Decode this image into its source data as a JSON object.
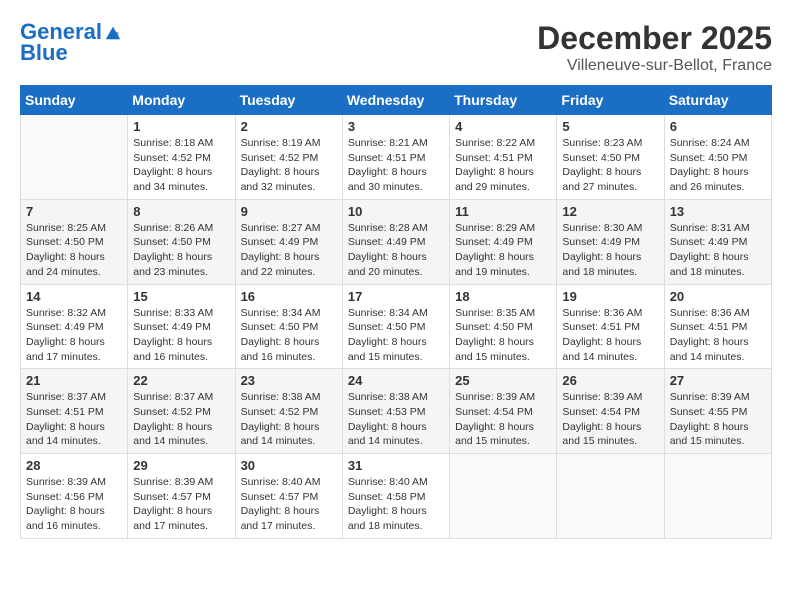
{
  "header": {
    "logo_line1": "General",
    "logo_line2": "Blue",
    "month_title": "December 2025",
    "location": "Villeneuve-sur-Bellot, France"
  },
  "weekdays": [
    "Sunday",
    "Monday",
    "Tuesday",
    "Wednesday",
    "Thursday",
    "Friday",
    "Saturday"
  ],
  "weeks": [
    [
      {
        "day": "",
        "sunrise": "",
        "sunset": "",
        "daylight": ""
      },
      {
        "day": "1",
        "sunrise": "Sunrise: 8:18 AM",
        "sunset": "Sunset: 4:52 PM",
        "daylight": "Daylight: 8 hours and 34 minutes."
      },
      {
        "day": "2",
        "sunrise": "Sunrise: 8:19 AM",
        "sunset": "Sunset: 4:52 PM",
        "daylight": "Daylight: 8 hours and 32 minutes."
      },
      {
        "day": "3",
        "sunrise": "Sunrise: 8:21 AM",
        "sunset": "Sunset: 4:51 PM",
        "daylight": "Daylight: 8 hours and 30 minutes."
      },
      {
        "day": "4",
        "sunrise": "Sunrise: 8:22 AM",
        "sunset": "Sunset: 4:51 PM",
        "daylight": "Daylight: 8 hours and 29 minutes."
      },
      {
        "day": "5",
        "sunrise": "Sunrise: 8:23 AM",
        "sunset": "Sunset: 4:50 PM",
        "daylight": "Daylight: 8 hours and 27 minutes."
      },
      {
        "day": "6",
        "sunrise": "Sunrise: 8:24 AM",
        "sunset": "Sunset: 4:50 PM",
        "daylight": "Daylight: 8 hours and 26 minutes."
      }
    ],
    [
      {
        "day": "7",
        "sunrise": "Sunrise: 8:25 AM",
        "sunset": "Sunset: 4:50 PM",
        "daylight": "Daylight: 8 hours and 24 minutes."
      },
      {
        "day": "8",
        "sunrise": "Sunrise: 8:26 AM",
        "sunset": "Sunset: 4:50 PM",
        "daylight": "Daylight: 8 hours and 23 minutes."
      },
      {
        "day": "9",
        "sunrise": "Sunrise: 8:27 AM",
        "sunset": "Sunset: 4:49 PM",
        "daylight": "Daylight: 8 hours and 22 minutes."
      },
      {
        "day": "10",
        "sunrise": "Sunrise: 8:28 AM",
        "sunset": "Sunset: 4:49 PM",
        "daylight": "Daylight: 8 hours and 20 minutes."
      },
      {
        "day": "11",
        "sunrise": "Sunrise: 8:29 AM",
        "sunset": "Sunset: 4:49 PM",
        "daylight": "Daylight: 8 hours and 19 minutes."
      },
      {
        "day": "12",
        "sunrise": "Sunrise: 8:30 AM",
        "sunset": "Sunset: 4:49 PM",
        "daylight": "Daylight: 8 hours and 18 minutes."
      },
      {
        "day": "13",
        "sunrise": "Sunrise: 8:31 AM",
        "sunset": "Sunset: 4:49 PM",
        "daylight": "Daylight: 8 hours and 18 minutes."
      }
    ],
    [
      {
        "day": "14",
        "sunrise": "Sunrise: 8:32 AM",
        "sunset": "Sunset: 4:49 PM",
        "daylight": "Daylight: 8 hours and 17 minutes."
      },
      {
        "day": "15",
        "sunrise": "Sunrise: 8:33 AM",
        "sunset": "Sunset: 4:49 PM",
        "daylight": "Daylight: 8 hours and 16 minutes."
      },
      {
        "day": "16",
        "sunrise": "Sunrise: 8:34 AM",
        "sunset": "Sunset: 4:50 PM",
        "daylight": "Daylight: 8 hours and 16 minutes."
      },
      {
        "day": "17",
        "sunrise": "Sunrise: 8:34 AM",
        "sunset": "Sunset: 4:50 PM",
        "daylight": "Daylight: 8 hours and 15 minutes."
      },
      {
        "day": "18",
        "sunrise": "Sunrise: 8:35 AM",
        "sunset": "Sunset: 4:50 PM",
        "daylight": "Daylight: 8 hours and 15 minutes."
      },
      {
        "day": "19",
        "sunrise": "Sunrise: 8:36 AM",
        "sunset": "Sunset: 4:51 PM",
        "daylight": "Daylight: 8 hours and 14 minutes."
      },
      {
        "day": "20",
        "sunrise": "Sunrise: 8:36 AM",
        "sunset": "Sunset: 4:51 PM",
        "daylight": "Daylight: 8 hours and 14 minutes."
      }
    ],
    [
      {
        "day": "21",
        "sunrise": "Sunrise: 8:37 AM",
        "sunset": "Sunset: 4:51 PM",
        "daylight": "Daylight: 8 hours and 14 minutes."
      },
      {
        "day": "22",
        "sunrise": "Sunrise: 8:37 AM",
        "sunset": "Sunset: 4:52 PM",
        "daylight": "Daylight: 8 hours and 14 minutes."
      },
      {
        "day": "23",
        "sunrise": "Sunrise: 8:38 AM",
        "sunset": "Sunset: 4:52 PM",
        "daylight": "Daylight: 8 hours and 14 minutes."
      },
      {
        "day": "24",
        "sunrise": "Sunrise: 8:38 AM",
        "sunset": "Sunset: 4:53 PM",
        "daylight": "Daylight: 8 hours and 14 minutes."
      },
      {
        "day": "25",
        "sunrise": "Sunrise: 8:39 AM",
        "sunset": "Sunset: 4:54 PM",
        "daylight": "Daylight: 8 hours and 15 minutes."
      },
      {
        "day": "26",
        "sunrise": "Sunrise: 8:39 AM",
        "sunset": "Sunset: 4:54 PM",
        "daylight": "Daylight: 8 hours and 15 minutes."
      },
      {
        "day": "27",
        "sunrise": "Sunrise: 8:39 AM",
        "sunset": "Sunset: 4:55 PM",
        "daylight": "Daylight: 8 hours and 15 minutes."
      }
    ],
    [
      {
        "day": "28",
        "sunrise": "Sunrise: 8:39 AM",
        "sunset": "Sunset: 4:56 PM",
        "daylight": "Daylight: 8 hours and 16 minutes."
      },
      {
        "day": "29",
        "sunrise": "Sunrise: 8:39 AM",
        "sunset": "Sunset: 4:57 PM",
        "daylight": "Daylight: 8 hours and 17 minutes."
      },
      {
        "day": "30",
        "sunrise": "Sunrise: 8:40 AM",
        "sunset": "Sunset: 4:57 PM",
        "daylight": "Daylight: 8 hours and 17 minutes."
      },
      {
        "day": "31",
        "sunrise": "Sunrise: 8:40 AM",
        "sunset": "Sunset: 4:58 PM",
        "daylight": "Daylight: 8 hours and 18 minutes."
      },
      {
        "day": "",
        "sunrise": "",
        "sunset": "",
        "daylight": ""
      },
      {
        "day": "",
        "sunrise": "",
        "sunset": "",
        "daylight": ""
      },
      {
        "day": "",
        "sunrise": "",
        "sunset": "",
        "daylight": ""
      }
    ]
  ]
}
